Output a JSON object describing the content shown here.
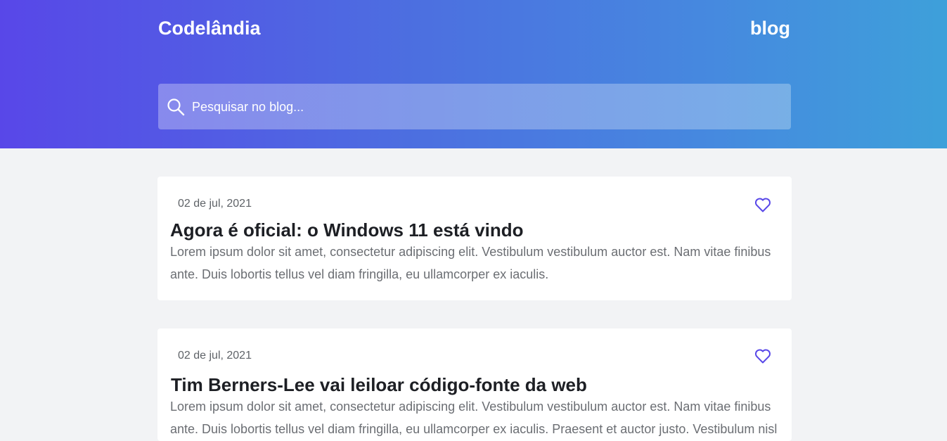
{
  "header": {
    "brand": "Codelândia",
    "nav_link": "blog"
  },
  "search": {
    "placeholder": "Pesquisar no blog..."
  },
  "posts": [
    {
      "date": "02 de jul, 2021",
      "title": "Agora é oficial: o Windows 11 está vindo",
      "excerpt": "Lorem ipsum dolor sit amet, consectetur adipiscing elit. Vestibulum vestibulum auctor est. Nam vitae finibus ante. Duis lobortis tellus vel diam fringilla, eu ullamcorper ex iaculis."
    },
    {
      "date": "02 de jul, 2021",
      "title": "Tim Berners-Lee vai leiloar código-fonte da web",
      "excerpt": "Lorem ipsum dolor sit amet, consectetur adipiscing elit. Vestibulum vestibulum auctor est. Nam vitae finibus ante. Duis lobortis tellus vel diam fringilla, eu ullamcorper ex iaculis. Praesent et auctor justo. Vestibulum nisl"
    }
  ],
  "colors": {
    "header_gradient_start": "#5847e8",
    "header_gradient_end": "#3ea0da",
    "accent": "#5847e8",
    "page_background": "#f2f3f5"
  },
  "icons": {
    "search": "search-icon",
    "like": "heart-icon"
  }
}
